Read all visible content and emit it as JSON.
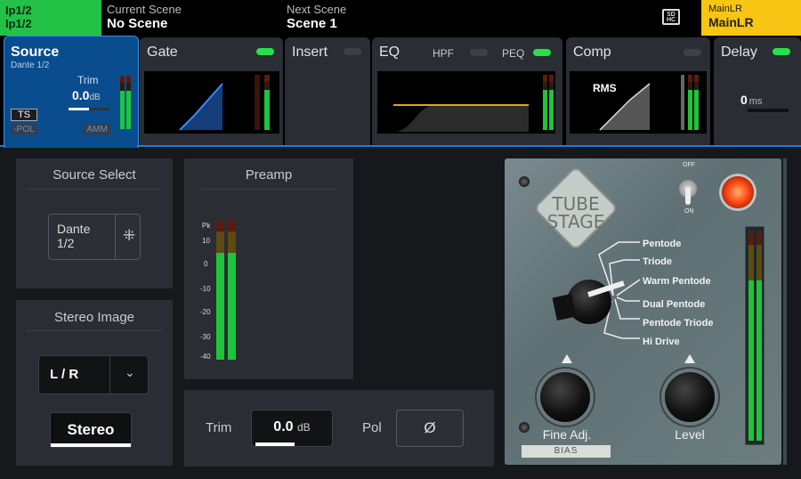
{
  "topbar": {
    "channel_line1": "Ip1/2",
    "channel_line2": "Ip1/2",
    "current_scene_label": "Current Scene",
    "current_scene_value": "No Scene",
    "next_scene_label": "Next Scene",
    "next_scene_value": "Scene 1",
    "sd_icon": "sd-card-icon",
    "sd_text": "SD HC",
    "mix_line1": "MainLR",
    "mix_line2": "MainLR",
    "channel_color": "#22c247",
    "mix_color": "#f7c514"
  },
  "strip": {
    "source": {
      "title": "Source",
      "subtitle": "Dante 1/2",
      "trim_label": "Trim",
      "trim_value": "0.0",
      "trim_unit": "dB",
      "ts_badge": "TS",
      "pol_badge": "-POL",
      "amm_badge": "AMM"
    },
    "gate": {
      "title": "Gate",
      "enabled": true
    },
    "insert": {
      "title": "Insert",
      "enabled": false
    },
    "eq": {
      "title": "EQ",
      "hpf_label": "HPF",
      "hpf_enabled": false,
      "peq_label": "PEQ",
      "peq_enabled": true
    },
    "comp": {
      "title": "Comp",
      "mode": "RMS",
      "enabled": false
    },
    "delay": {
      "title": "Delay",
      "value": "0",
      "unit": "ms",
      "enabled": true
    }
  },
  "source_select": {
    "title": "Source Select",
    "value_line1": "Dante",
    "value_line2": "1/2",
    "network_icon": "network-icon"
  },
  "stereo_image": {
    "title": "Stereo Image",
    "mode": "L / R",
    "dropdown_icon": "chevron-down-icon",
    "stereo_button": "Stereo"
  },
  "preamp": {
    "title": "Preamp",
    "scale": [
      "Pk",
      "10",
      "0",
      "-10",
      "-20",
      "-30",
      "-40"
    ],
    "trim_label": "Trim",
    "trim_value": "0.0",
    "trim_unit": "dB",
    "pol_label": "Pol",
    "pol_symbol": "Ø"
  },
  "plugin": {
    "logo_line1": "TUBE",
    "logo_line2": "STAGE",
    "switch_off_label": "OFF",
    "switch_on_label": "ON",
    "options": [
      "Pentode",
      "Triode",
      "Warm Pentode",
      "Dual Pentode",
      "Pentode Triode",
      "Hi Drive"
    ],
    "selected_option": "Warm Pentode",
    "fine_label": "Fine Adj.",
    "bias_label": "BIAS",
    "level_label": "Level",
    "lamp_color": "#ff4a12"
  }
}
